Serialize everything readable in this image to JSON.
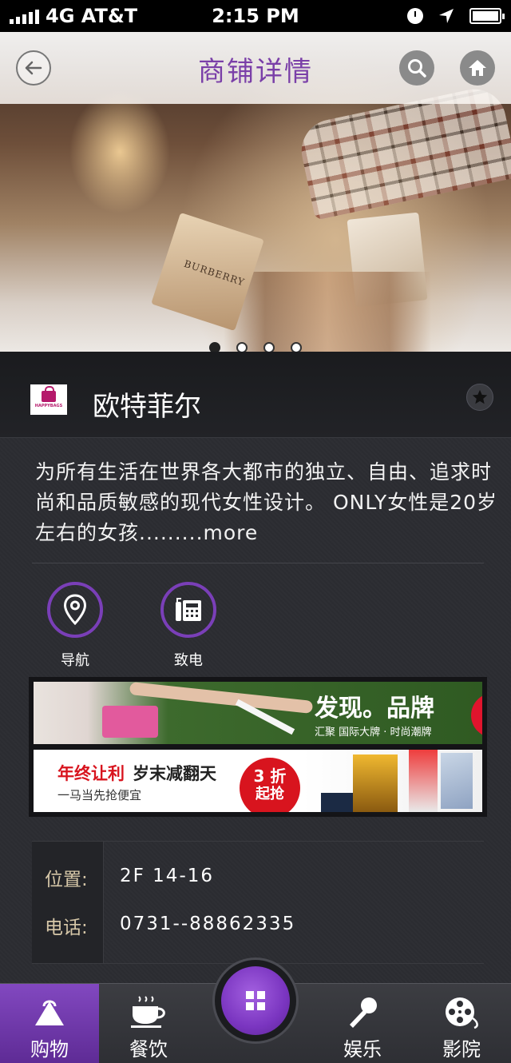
{
  "status_bar": {
    "carrier": "4G AT&T",
    "time": "2:15 PM"
  },
  "header": {
    "title": "商铺详情"
  },
  "carousel": {
    "bag_brand": "BURBERRY",
    "slide_count": 4,
    "active_slide": 1
  },
  "store": {
    "logo_text": "HAPPYBAGS",
    "name": "欧特菲尔",
    "description": "为所有生活在世界各大都市的独立、自由、追求时尚和品质敏感的现代女性设计。 ONLY女性是20岁左右的女孩.........",
    "more_label": "more"
  },
  "actions": {
    "navigate_label": "导航",
    "call_label": "致电"
  },
  "ads": {
    "ad1_title": "发现。品牌",
    "ad1_subtitle": "汇聚 国际大牌 · 时尚潮牌",
    "ad2_title_red": "年终让利",
    "ad2_title_black": "岁末减翻天",
    "ad2_subtitle": "一马当先抢便宜",
    "ad2_burst_top": "3 折",
    "ad2_burst_bottom": "起抢"
  },
  "info": {
    "location_label": "位置:",
    "location_value": "2F 14-16",
    "phone_label": "电话:",
    "phone_value": "0731--88862335"
  },
  "tabs": {
    "shopping": "购物",
    "dining": "餐饮",
    "entertainment": "娱乐",
    "cinema": "影院"
  },
  "colors": {
    "accent": "#7a3fb8",
    "title": "#7a3fa8",
    "label_gold": "#d6c7a8",
    "background": "#2b2c31"
  }
}
